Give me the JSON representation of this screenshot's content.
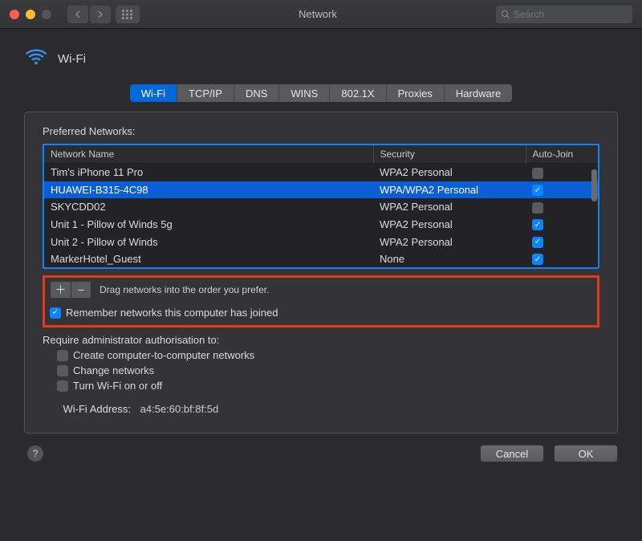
{
  "window": {
    "title": "Network",
    "search_placeholder": "Search"
  },
  "header": {
    "title": "Wi-Fi"
  },
  "tabs": [
    {
      "label": "Wi-Fi",
      "selected": true
    },
    {
      "label": "TCP/IP",
      "selected": false
    },
    {
      "label": "DNS",
      "selected": false
    },
    {
      "label": "WINS",
      "selected": false
    },
    {
      "label": "802.1X",
      "selected": false
    },
    {
      "label": "Proxies",
      "selected": false
    },
    {
      "label": "Hardware",
      "selected": false
    }
  ],
  "preferred_networks": {
    "label": "Preferred Networks:",
    "columns": {
      "name": "Network Name",
      "security": "Security",
      "autojoin": "Auto-Join"
    },
    "rows": [
      {
        "name": "Tim's iPhone 11 Pro",
        "security": "WPA2 Personal",
        "autojoin": false,
        "selected": false
      },
      {
        "name": "HUAWEI-B315-4C98",
        "security": "WPA/WPA2 Personal",
        "autojoin": true,
        "selected": true
      },
      {
        "name": "SKYCDD02",
        "security": "WPA2 Personal",
        "autojoin": false,
        "selected": false
      },
      {
        "name": "Unit 1 - Pillow of Winds 5g",
        "security": "WPA2 Personal",
        "autojoin": true,
        "selected": false
      },
      {
        "name": "Unit 2 - Pillow of Winds",
        "security": "WPA2 Personal",
        "autojoin": true,
        "selected": false
      },
      {
        "name": "MarkerHotel_Guest",
        "security": "None",
        "autojoin": true,
        "selected": false
      }
    ]
  },
  "drag_hint": "Drag networks into the order you prefer.",
  "remember": {
    "label": "Remember networks this computer has joined",
    "checked": true
  },
  "admin": {
    "label": "Require administrator authorisation to:",
    "options": [
      {
        "label": "Create computer-to-computer networks",
        "checked": false
      },
      {
        "label": "Change networks",
        "checked": false
      },
      {
        "label": "Turn Wi-Fi on or off",
        "checked": false
      }
    ]
  },
  "wifi_address": {
    "label": "Wi-Fi Address:",
    "value": "a4:5e:60:bf:8f:5d"
  },
  "buttons": {
    "cancel": "Cancel",
    "ok": "OK"
  }
}
